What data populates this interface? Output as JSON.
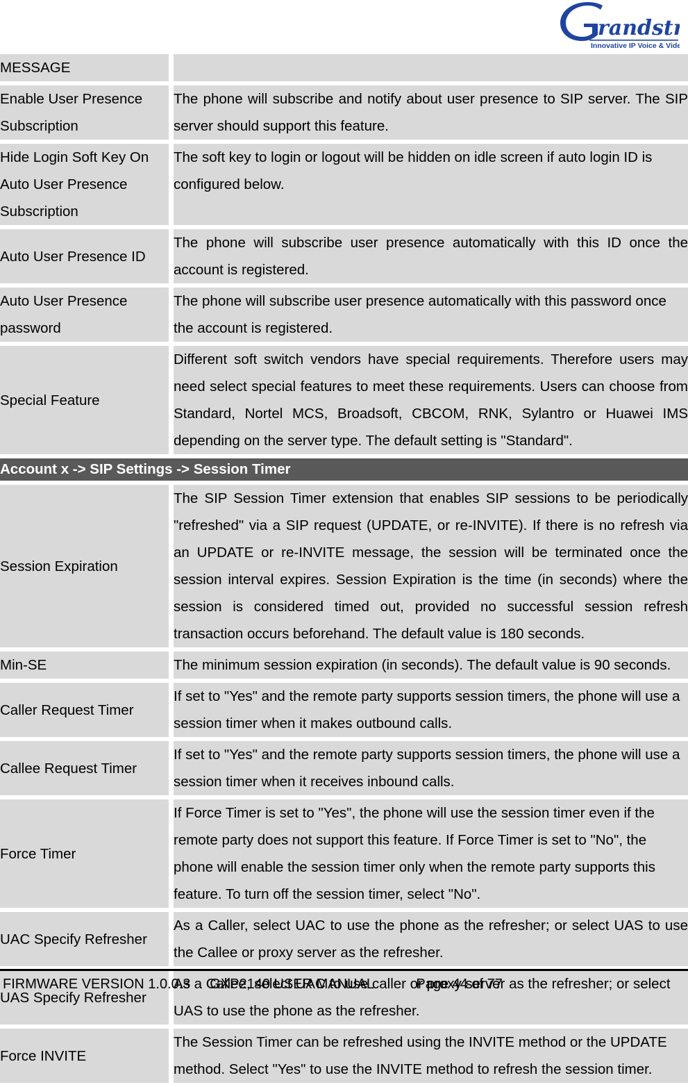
{
  "header": {
    "logo_name": "Grandstream",
    "logo_tagline": "Innovative IP Voice & Video"
  },
  "table": {
    "rows": [
      {
        "kind": "label-row",
        "label": "MESSAGE",
        "description": ""
      },
      {
        "kind": "data-row",
        "label": "Enable User Presence Subscription",
        "description": "The phone will subscribe and notify about user presence to SIP server. The SIP server should support this feature.",
        "justified": true
      },
      {
        "kind": "data-row",
        "label": "Hide Login Soft Key On Auto User Presence Subscription",
        "description": "The soft key to login or logout will be hidden on idle screen if auto login ID is configured below.",
        "justified": false
      },
      {
        "kind": "data-row",
        "label": "Auto User Presence ID",
        "description": "The phone will subscribe user presence automatically with this ID once the account is registered.",
        "justified": true
      },
      {
        "kind": "data-row",
        "label": "Auto User Presence password",
        "description": "The phone will subscribe user presence automatically with this password once the account is registered.",
        "justified": false
      },
      {
        "kind": "data-row",
        "label": "Special Feature",
        "description": "Different soft switch vendors have special requirements. Therefore users may need select special features to meet these requirements. Users can choose from Standard, Nortel MCS, Broadsoft, CBCOM, RNK, Sylantro or Huawei IMS depending on the server type. The default setting is \"Standard\".",
        "justified": true
      },
      {
        "kind": "section",
        "label": "Account x -> SIP Settings -> Session Timer"
      },
      {
        "kind": "data-row",
        "label": "Session Expiration",
        "description": "The SIP Session Timer extension that enables SIP sessions to be periodically \"refreshed\" via a SIP request (UPDATE, or re-INVITE). If there is no refresh via an UPDATE or re-INVITE message, the session will be terminated once the session interval expires. Session Expiration is the time (in seconds) where the session is considered timed out, provided no successful session refresh transaction occurs beforehand. The default value is 180 seconds.",
        "justified": true
      },
      {
        "kind": "data-row",
        "label": "Min-SE",
        "description": "The minimum session expiration (in seconds). The default value is 90 seconds.",
        "justified": true
      },
      {
        "kind": "data-row",
        "label": "Caller Request Timer",
        "description": "If set to \"Yes\" and the remote party supports session timers, the phone will use a session timer when it makes outbound calls.",
        "justified": false
      },
      {
        "kind": "data-row",
        "label": "Callee Request Timer",
        "description": "If set to \"Yes\" and the remote party supports session timers, the phone will use a session timer when it receives inbound calls.",
        "justified": false
      },
      {
        "kind": "data-row",
        "label": "Force Timer",
        "description": "If Force Timer is set to \"Yes\", the phone will use the session timer even if the remote party does not support this feature. If Force Timer is set to \"No\", the phone will enable the session timer only when the remote party supports this feature. To turn off the session timer, select \"No\".",
        "justified": false
      },
      {
        "kind": "data-row",
        "label": "UAC Specify Refresher",
        "description": "As a Caller, select UAC to use the phone as the refresher; or select UAS to use the Callee or proxy server as the refresher.",
        "justified": true
      },
      {
        "kind": "data-row",
        "label": "UAS Specify Refresher",
        "description": "As a Callee, select UAC to use caller or proxy server as the refresher; or select UAS to use the phone as the refresher.",
        "justified": false
      },
      {
        "kind": "data-row",
        "label": "Force INVITE",
        "description": "The Session Timer can be refreshed using the INVITE method or the UPDATE method. Select \"Yes\" to use the INVITE method to refresh the session timer.",
        "justified": false
      }
    ]
  },
  "footer": {
    "text": "FIRMWARE VERSION 1.0.0.3     GXP2140 USER MANUAL           Page 44 of 77"
  },
  "colors": {
    "cell_background": "#d9d9d9",
    "section_background": "#595959",
    "logo_blue": "#1f44a0",
    "page_background": "#ffffff"
  }
}
